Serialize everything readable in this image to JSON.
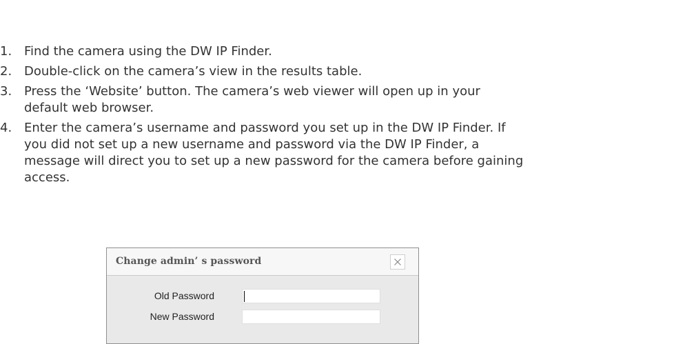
{
  "instructions": {
    "steps": [
      {
        "number": "1.",
        "text": "Find the camera using the DW IP Finder."
      },
      {
        "number": "2.",
        "text": "Double-click on the camera’s view in the results table."
      },
      {
        "number": "3.",
        "text": "Press the ‘Website’ button. The camera’s web viewer will open up in your default web browser."
      },
      {
        "number": "4.",
        "text": "Enter the camera’s username and password you set up in the DW IP Finder. If you did not set up a new username and password via the DW IP Finder, a message will direct you to set up a new password for the camera before gaining access."
      }
    ]
  },
  "dialog": {
    "title": "Change admin’ s password",
    "close_icon": "close-icon",
    "fields": [
      {
        "label": "Old Password",
        "value": ""
      },
      {
        "label": "New Password",
        "value": ""
      }
    ]
  },
  "colors": {
    "body_text": "#333333",
    "dialog_border": "#8f8f8f",
    "dialog_header_bg": "#f7f7f7",
    "dialog_body_bg": "#e9e9e9"
  }
}
